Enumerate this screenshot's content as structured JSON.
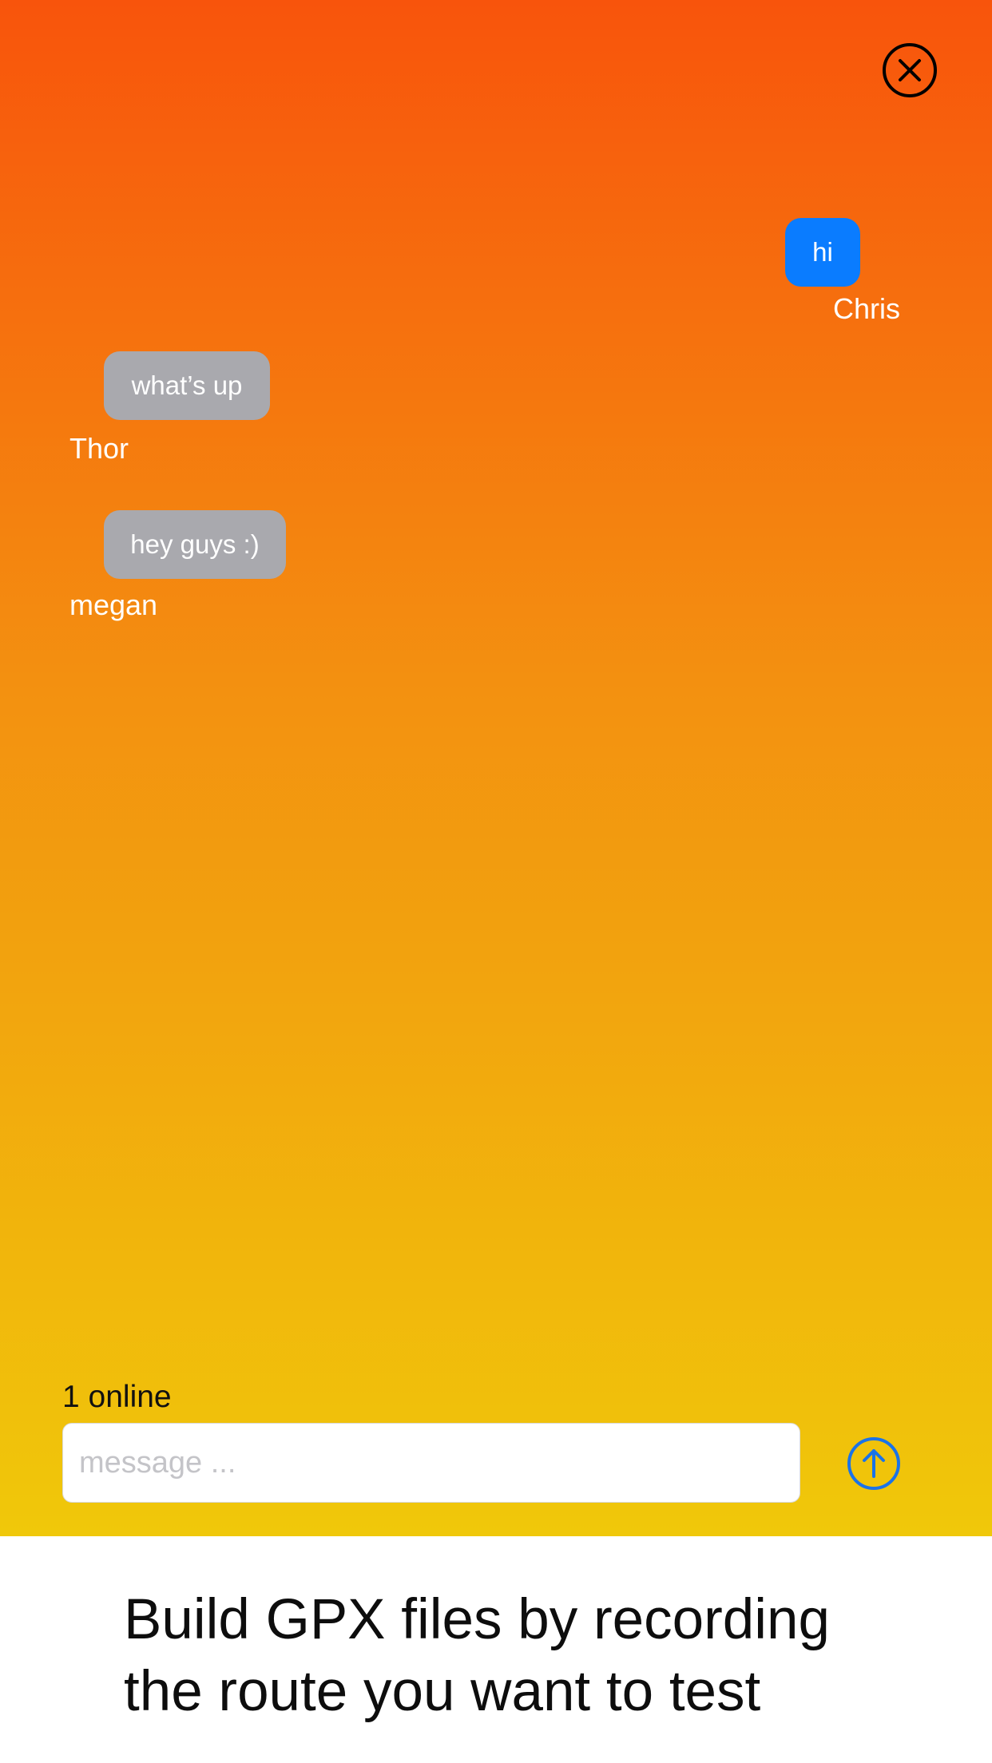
{
  "chat": {
    "close_icon": "close-circle-icon",
    "messages": [
      {
        "text": "hi",
        "sender": "Chris",
        "direction": "sent"
      },
      {
        "text": "what’s up",
        "sender": "Thor",
        "direction": "received"
      },
      {
        "text": "hey guys :)",
        "sender": "megan",
        "direction": "received"
      }
    ],
    "online_status": "1 online",
    "input": {
      "placeholder": "message ...",
      "value": ""
    },
    "send_icon": "arrow-up-circle-icon"
  },
  "caption": {
    "text": "Build GPX files by recording the route you want to test"
  },
  "colors": {
    "gradient_top": "#f8540c",
    "gradient_bottom": "#f0c80a",
    "sent_bubble": "#0a7cff",
    "received_bubble": "#a9a9ae",
    "send_icon": "#1a73e8"
  }
}
